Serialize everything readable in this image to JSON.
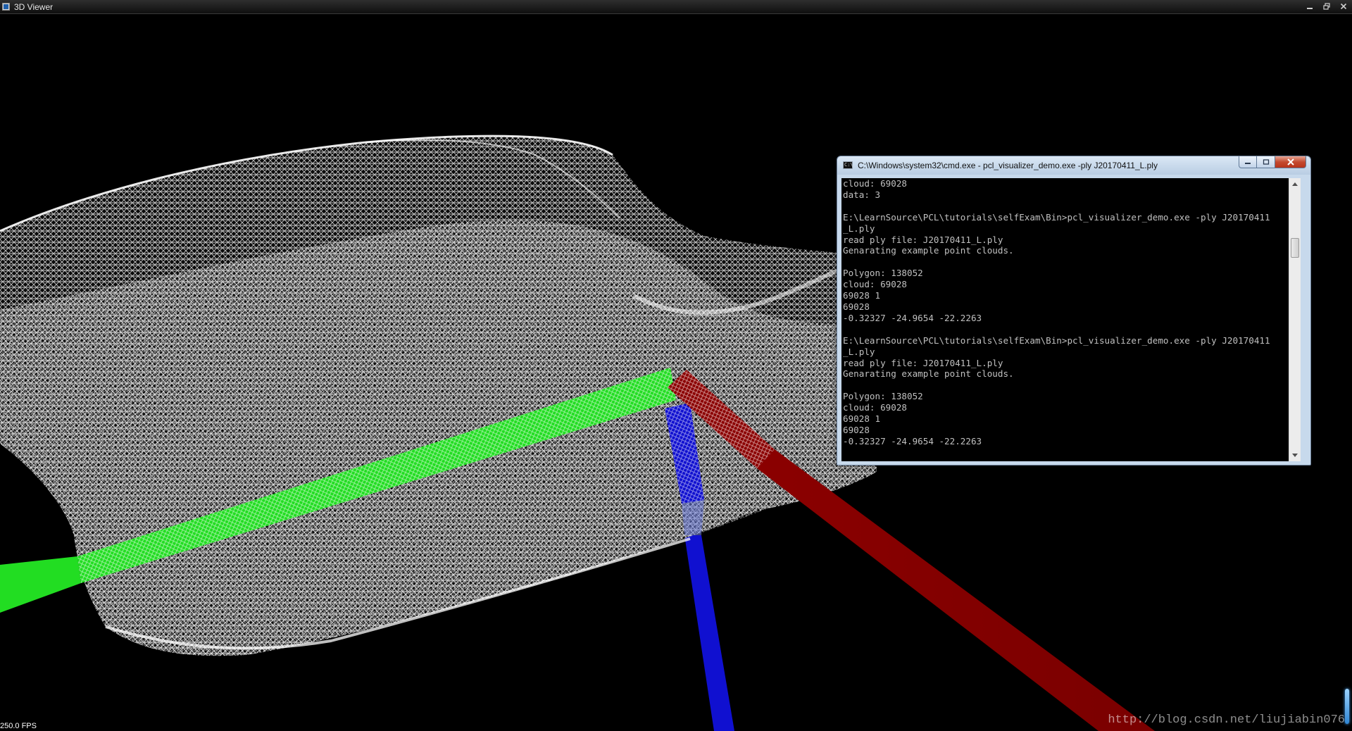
{
  "viewer": {
    "title": "3D Viewer",
    "fps": "250.0 FPS",
    "watermark": "http://blog.csdn.net/liujiabin076",
    "axis_colors": {
      "x": "#8b0000",
      "y": "#22dd22",
      "z": "#1010d0"
    },
    "mesh_color": "#ffffff",
    "background": "#000000"
  },
  "console": {
    "title": "C:\\Windows\\system32\\cmd.exe - pcl_visualizer_demo.exe  -ply J20170411_L.ply",
    "icon_text": "C:\\",
    "lines": [
      "cloud: 69028",
      "data: 3",
      "",
      "E:\\LearnSource\\PCL\\tutorials\\selfExam\\Bin>pcl_visualizer_demo.exe -ply J20170411",
      "_L.ply",
      "read ply file: J20170411_L.ply",
      "Genarating example point clouds.",
      "",
      "Polygon: 138052",
      "cloud: 69028",
      "69028 1",
      "69028",
      "-0.32327 -24.9654 -22.2263",
      "",
      "E:\\LearnSource\\PCL\\tutorials\\selfExam\\Bin>pcl_visualizer_demo.exe -ply J20170411",
      "_L.ply",
      "read ply file: J20170411_L.ply",
      "Genarating example point clouds.",
      "",
      "Polygon: 138052",
      "cloud: 69028",
      "69028 1",
      "69028",
      "-0.32327 -24.9654 -22.2263"
    ],
    "scroll_position": 0.2
  },
  "icons": {
    "minimize": "minimize-icon",
    "maximize": "maximize-icon",
    "close": "close-icon"
  }
}
